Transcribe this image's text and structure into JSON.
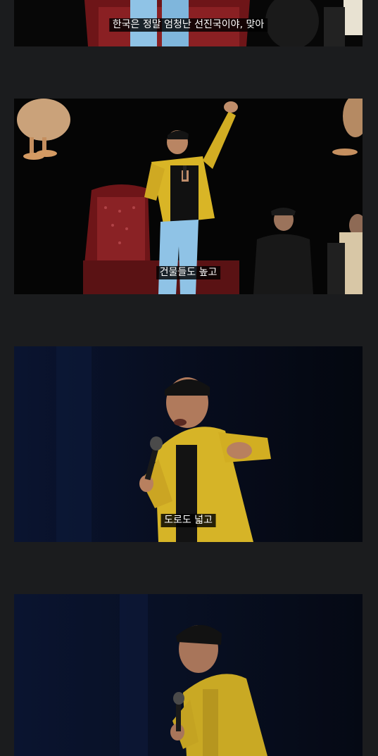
{
  "feed": {
    "frames": [
      {
        "subtitle": "한국은 정말 엄청난 선진국이야, 맞아"
      },
      {
        "subtitle": "건물들도 높고"
      },
      {
        "subtitle": "도로도 넓고"
      },
      {
        "subtitle": ""
      }
    ]
  },
  "colors": {
    "page_background": "#1b1c1e",
    "jacket_yellow": "#d9b526",
    "stage_blue_dark": "#0b1226",
    "chair_red": "#7a1a1c",
    "jeans_blue": "#8fc3e6"
  }
}
